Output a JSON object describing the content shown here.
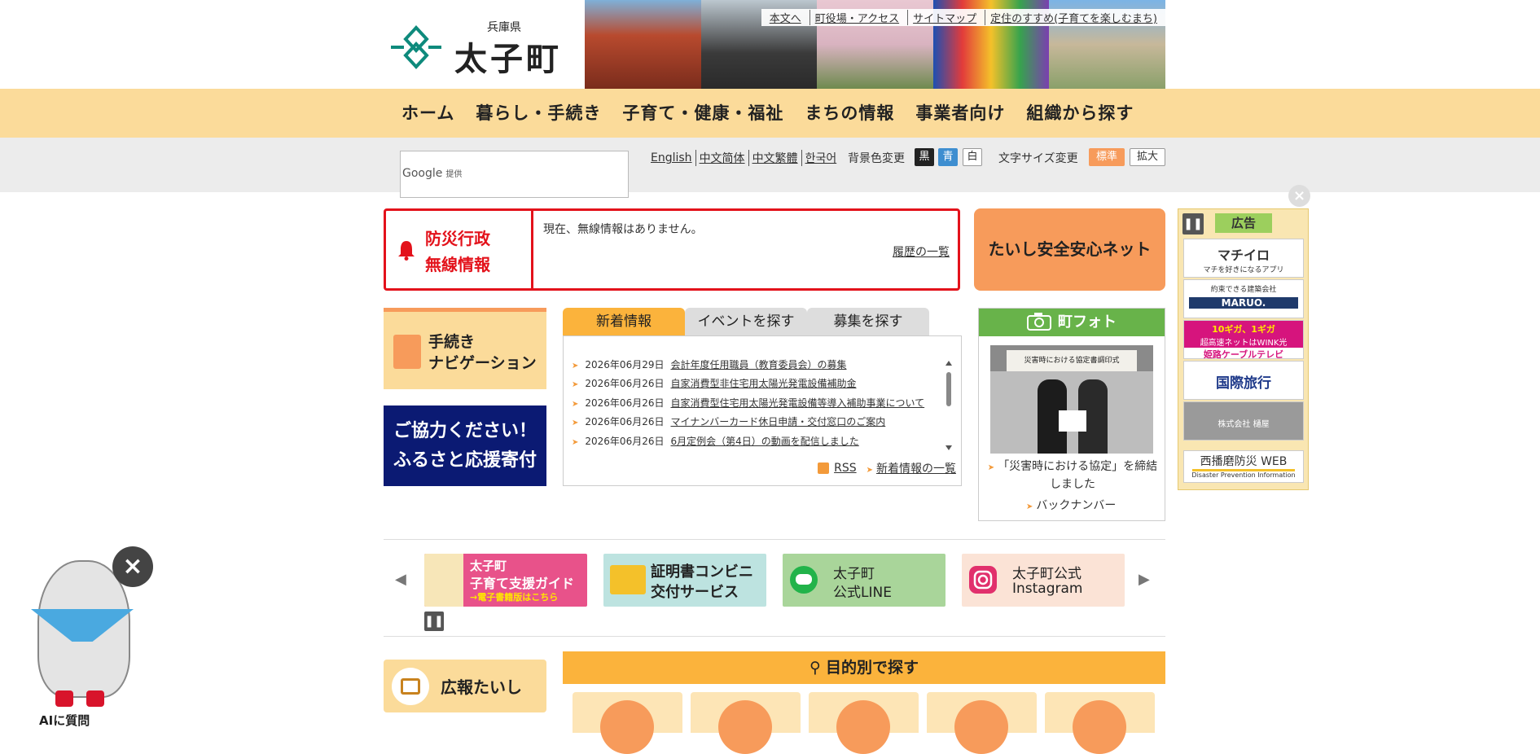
{
  "header": {
    "prefecture": "兵庫県",
    "town": "太子町",
    "util_links": [
      "本文へ",
      "町役場・アクセス",
      "サイトマップ",
      "定住のすすめ(子育てを楽しむまち)"
    ]
  },
  "gnav": [
    "ホーム",
    "暮らし・手続き",
    "子育て・健康・福祉",
    "まちの情報",
    "事業者向け",
    "組織から探す"
  ],
  "toolbar": {
    "search_brand": "Google",
    "search_provided": "提供",
    "languages": [
      "English",
      "中文简体",
      "中文繁體",
      "한국어"
    ],
    "bg_label": "背景色変更",
    "bg_options": [
      "黒",
      "青",
      "白"
    ],
    "size_label": "文字サイズ変更",
    "size_options": [
      "標準",
      "拡大"
    ]
  },
  "radio": {
    "title_line1": "防災行政",
    "title_line2": "無線情報",
    "message": "現在、無線情報はありません。",
    "history": "履歴の一覧"
  },
  "safe_net": "たいし安全安心ネット",
  "left": {
    "proc_line1": "手続き",
    "proc_line2": "ナビゲーション",
    "furusato_line1": "ご協力ください！",
    "furusato_line2": "ふるさと応援寄付"
  },
  "news": {
    "tabs": [
      "新着情報",
      "イベントを探す",
      "募集を探す"
    ],
    "items": [
      {
        "date": "2026年06月29日",
        "title": "会計年度任用職員（教育委員会）の募集"
      },
      {
        "date": "2026年06月26日",
        "title": "自家消費型非住宅用太陽光発電設備補助金"
      },
      {
        "date": "2026年06月26日",
        "title": "自家消費型住宅用太陽光発電設備等導入補助事業について"
      },
      {
        "date": "2026年06月26日",
        "title": "マイナンバーカード休日申請・交付窓口のご案内"
      },
      {
        "date": "2026年06月26日",
        "title": "6月定例会（第4日）の動画を配信しました"
      }
    ],
    "rss": "RSS",
    "list_link": "新着情報の一覧"
  },
  "photo": {
    "title": "町フォト",
    "sign": "災害時における協定書調印式",
    "caption": "「災害時における協定」を締結しました",
    "back": "バックナンバー"
  },
  "ad": {
    "label": "広告",
    "items": [
      "マチイロ",
      "マチを好きになるアプリ",
      "約束できる建築会社",
      "MARUO.",
      "10ギガ、1ギガ",
      "超高速ネットはWINK光",
      "姫路ケーブルテレビ",
      "国際旅行",
      "株式会社 樋屋",
      "西播磨防災 WEB",
      "Disaster Prevention Information"
    ]
  },
  "carousel": {
    "items": [
      {
        "line1": "太子町",
        "line2": "子育て支援ガイド",
        "line3": "→電子書籍版はこちら"
      },
      {
        "line1": "証明書コンビニ",
        "line2": "交付サービス"
      },
      {
        "line1": "太子町",
        "line2": "公式LINE"
      },
      {
        "line1": "太子町公式",
        "line2": "Instagram"
      }
    ]
  },
  "bottom": {
    "koho": "広報たいし",
    "purpose": "目的別で探す"
  },
  "mascot": {
    "label": "AIに質問"
  },
  "colors": {
    "accent": "#fbdb9a",
    "orange": "#f79b5b",
    "alert": "#e3121b",
    "navy": "#0b1a73",
    "green": "#68b34a"
  }
}
